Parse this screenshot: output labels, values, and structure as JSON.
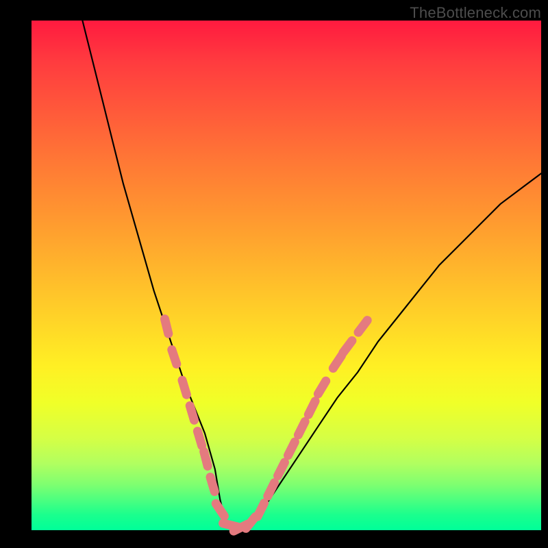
{
  "watermark": "TheBottleneck.com",
  "colors": {
    "background": "#000000",
    "gradient_top": "#ff1a3f",
    "gradient_bottom": "#00ff99",
    "curve": "#000000",
    "markers": "#e47a7f"
  },
  "chart_data": {
    "type": "line",
    "title": "",
    "xlabel": "",
    "ylabel": "",
    "xlim": [
      0,
      100
    ],
    "ylim": [
      0,
      100
    ],
    "grid": false,
    "series": [
      {
        "name": "bottleneck-curve",
        "x": [
          10,
          12,
          14,
          16,
          18,
          20,
          22,
          24,
          26,
          28,
          30,
          32,
          34,
          36,
          37,
          38,
          40,
          42,
          44,
          48,
          52,
          56,
          60,
          64,
          68,
          72,
          76,
          80,
          84,
          88,
          92,
          96,
          100
        ],
        "y": [
          100,
          92,
          84,
          76,
          68,
          61,
          54,
          47,
          41,
          35,
          29,
          24,
          19,
          12,
          6,
          2,
          0,
          0,
          2,
          8,
          14,
          20,
          26,
          31,
          37,
          42,
          47,
          52,
          56,
          60,
          64,
          67,
          70
        ]
      }
    ],
    "markers": [
      {
        "x": 26.5,
        "y": 40
      },
      {
        "x": 28.0,
        "y": 34
      },
      {
        "x": 30.0,
        "y": 28
      },
      {
        "x": 31.5,
        "y": 23
      },
      {
        "x": 33.0,
        "y": 18
      },
      {
        "x": 34.2,
        "y": 14
      },
      {
        "x": 35.5,
        "y": 9
      },
      {
        "x": 37.0,
        "y": 4
      },
      {
        "x": 39.0,
        "y": 1
      },
      {
        "x": 41.0,
        "y": 0.5
      },
      {
        "x": 43.0,
        "y": 1.5
      },
      {
        "x": 45.0,
        "y": 4
      },
      {
        "x": 47.0,
        "y": 8
      },
      {
        "x": 49.0,
        "y": 12
      },
      {
        "x": 51.0,
        "y": 16
      },
      {
        "x": 53.0,
        "y": 20
      },
      {
        "x": 55.0,
        "y": 24
      },
      {
        "x": 57.0,
        "y": 28
      },
      {
        "x": 60.0,
        "y": 33
      },
      {
        "x": 62.0,
        "y": 36
      },
      {
        "x": 65.0,
        "y": 40
      }
    ]
  }
}
